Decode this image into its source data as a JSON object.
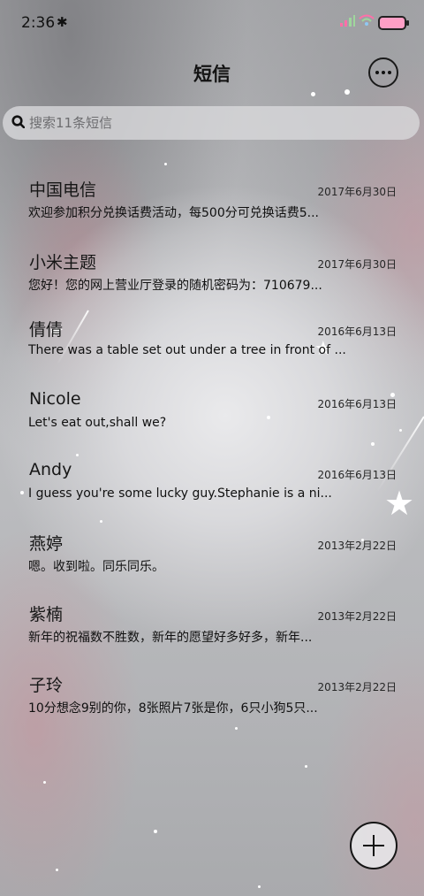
{
  "status": {
    "time": "2:36",
    "bluetooth_icon": "bluetooth-icon",
    "signal_icon": "signal-icon",
    "wifi_icon": "wifi-icon",
    "battery_icon": "battery-icon"
  },
  "header": {
    "title": "短信",
    "more_icon": "more-options-icon"
  },
  "search": {
    "placeholder": "搜索11条短信",
    "icon": "search-icon"
  },
  "messages": [
    {
      "name": "中国电信",
      "date": "2017年6月30日",
      "preview": "欢迎参加积分兑换话费活动，每500分可兑换话费5..."
    },
    {
      "name": "小米主题",
      "date": "2017年6月30日",
      "preview": "您好！您的网上营业厅登录的随机密码为：710679..."
    },
    {
      "name": "倩倩",
      "date": "2016年6月13日",
      "preview": "There was a table set out under a tree in front of ..."
    },
    {
      "name": "Nicole",
      "date": "2016年6月13日",
      "preview": "Let's eat out,shall we?"
    },
    {
      "name": "Andy",
      "date": "2016年6月13日",
      "preview": "I guess you're some lucky guy.Stephanie is a ni..."
    },
    {
      "name": "燕婷",
      "date": "2013年2月22日",
      "preview": "嗯。收到啦。同乐同乐。"
    },
    {
      "name": "紫楠",
      "date": "2013年2月22日",
      "preview": "新年的祝福数不胜数，新年的愿望好多好多，新年..."
    },
    {
      "name": "子玲",
      "date": "2013年2月22日",
      "preview": "10分想念9别的你，8张照片7张是你，6只小狗5只..."
    }
  ],
  "fab": {
    "icon": "plus-icon"
  }
}
